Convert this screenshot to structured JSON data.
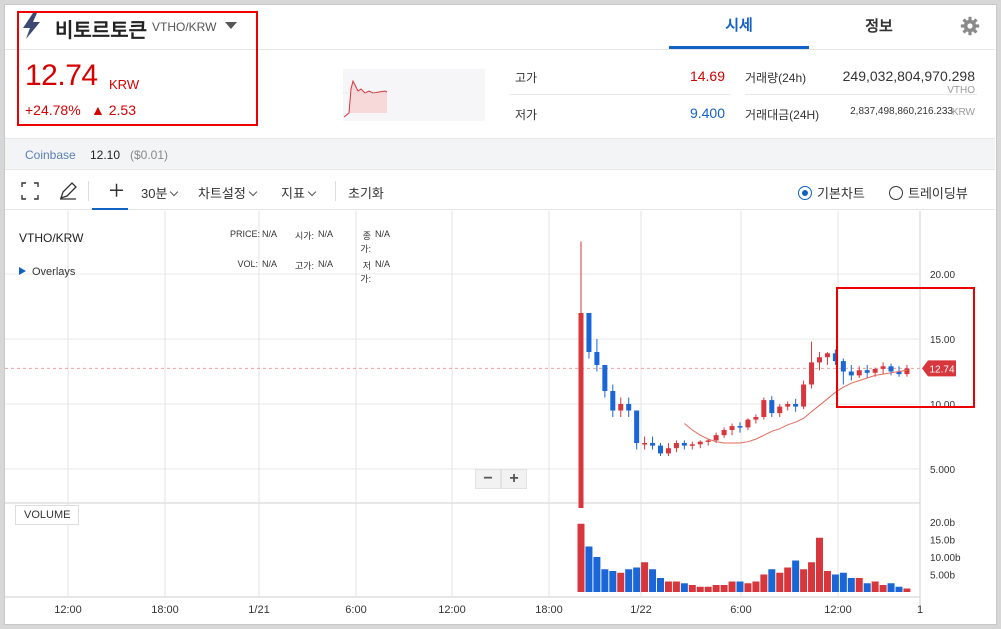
{
  "header": {
    "coin_name": "비토르토큰",
    "pair": "VTHO/KRW",
    "tabs": [
      "시세",
      "정보"
    ],
    "icons": {
      "coin": "lightning-bolt-icon",
      "dropdown": "caret-down-icon",
      "settings": "gear-icon"
    }
  },
  "ticker": {
    "price": "12.74",
    "unit": "KRW",
    "change_rate": "+24.78%",
    "change_amount": "▲ 2.53",
    "color_up": "#d60000"
  },
  "stats": {
    "high_label": "고가",
    "high_value": "14.69",
    "low_label": "저가",
    "low_value": "9.400",
    "volume_label": "거래량(24h)",
    "volume_value": "249,032,804,970.298",
    "volume_unit": "VTHO",
    "amount_label": "거래대금(24H)",
    "amount_value": "2,837,498,860,216.233",
    "amount_unit": "KRW"
  },
  "exchange": {
    "name": "Coinbase",
    "price": "12.10",
    "usd": "($0.01)"
  },
  "toolbar": {
    "interval": "30분",
    "chart_settings": "차트설정",
    "indicators": "지표",
    "reset": "초기화",
    "radio_basic": "기본차트",
    "radio_trading": "트레이딩뷰",
    "icons": [
      "crosshair-frame-icon",
      "pencil-icon",
      "plus-crosshair-icon"
    ]
  },
  "chart_info": {
    "symbol": "VTHO/KRW",
    "overlays": "Overlays",
    "price_label": "PRICE:",
    "price_value": "N/A",
    "open_label": "시가:",
    "open_value": "N/A",
    "close_label": "종가:",
    "close_value": "N/A",
    "vol_label": "VOL:",
    "vol_value": "N/A",
    "high_label": "고가:",
    "high_value": "N/A",
    "low_label": "저가:",
    "low_value": "N/A",
    "volume_title": "VOLUME",
    "current_price_tag": "12.74",
    "zoom_out": "−",
    "zoom_in": "+"
  },
  "chart_data": {
    "type": "candlestick",
    "y_ticks": [
      "20.00",
      "15.00",
      "10.00",
      "5.000"
    ],
    "volume_ticks": [
      "20.0b",
      "15.0b",
      "10.00b",
      "5.00b"
    ],
    "x_ticks": [
      "12:00",
      "18:00",
      "1/21",
      "6:00",
      "12:00",
      "18:00",
      "1/22",
      "6:00",
      "12:00",
      "1"
    ],
    "ylim": [
      0,
      24
    ],
    "current_price": 12.74,
    "colors": {
      "up": "#d8363d",
      "down": "#1a66d6",
      "ma": "#e06b5a"
    },
    "candles": [
      [
        2.0,
        22.5,
        2.0,
        17.0
      ],
      [
        17.0,
        17.0,
        13.5,
        14.0
      ],
      [
        14.0,
        15.0,
        12.5,
        13.0
      ],
      [
        13.0,
        13.0,
        10.5,
        11.0
      ],
      [
        11.0,
        11.5,
        9.0,
        9.5
      ],
      [
        9.5,
        10.5,
        9.0,
        10.0
      ],
      [
        10.0,
        10.5,
        9.0,
        9.5
      ],
      [
        9.5,
        9.5,
        6.5,
        7.0
      ],
      [
        7.0,
        7.5,
        6.5,
        7.0
      ],
      [
        7.0,
        7.5,
        6.5,
        6.8
      ],
      [
        6.8,
        7.0,
        6.0,
        6.2
      ],
      [
        6.2,
        7.0,
        6.0,
        6.6
      ],
      [
        6.6,
        7.2,
        6.3,
        7.0
      ],
      [
        7.0,
        7.2,
        6.5,
        6.8
      ],
      [
        6.8,
        7.1,
        6.5,
        6.9
      ],
      [
        6.9,
        7.2,
        6.6,
        7.1
      ],
      [
        7.1,
        7.3,
        6.8,
        7.2
      ],
      [
        7.2,
        7.8,
        7.0,
        7.6
      ],
      [
        7.6,
        8.2,
        7.4,
        8.0
      ],
      [
        8.0,
        8.5,
        7.6,
        8.3
      ],
      [
        8.3,
        8.6,
        7.8,
        8.2
      ],
      [
        8.2,
        8.9,
        8.0,
        8.8
      ],
      [
        8.8,
        9.2,
        8.5,
        9.0
      ],
      [
        9.0,
        10.5,
        8.8,
        10.3
      ],
      [
        10.3,
        10.6,
        9.0,
        9.3
      ],
      [
        9.3,
        10.0,
        9.0,
        9.8
      ],
      [
        9.8,
        10.2,
        9.5,
        10.0
      ],
      [
        10.0,
        10.4,
        9.4,
        9.8
      ],
      [
        9.8,
        11.8,
        9.6,
        11.5
      ],
      [
        11.5,
        14.8,
        11.2,
        13.2
      ],
      [
        13.2,
        14.0,
        12.6,
        13.6
      ],
      [
        13.6,
        14.0,
        13.0,
        13.9
      ],
      [
        13.9,
        14.2,
        13.0,
        13.3
      ],
      [
        13.3,
        13.5,
        11.5,
        12.5
      ],
      [
        12.5,
        13.0,
        11.8,
        12.2
      ],
      [
        12.2,
        12.9,
        12.0,
        12.6
      ],
      [
        12.6,
        13.0,
        12.0,
        12.4
      ],
      [
        12.4,
        12.8,
        12.1,
        12.7
      ],
      [
        12.7,
        13.2,
        12.3,
        12.9
      ],
      [
        12.9,
        13.1,
        12.2,
        12.5
      ],
      [
        12.5,
        12.9,
        12.1,
        12.3
      ],
      [
        12.3,
        13.0,
        12.1,
        12.74
      ]
    ],
    "volumes": [
      19.5,
      13.0,
      10.0,
      6.5,
      6.0,
      5.5,
      6.5,
      7.0,
      8.5,
      6.5,
      4.0,
      3.0,
      3.0,
      2.5,
      2.0,
      1.5,
      1.5,
      2.0,
      2.0,
      3.0,
      3.0,
      2.5,
      3.0,
      5.0,
      6.5,
      5.5,
      7.0,
      9.0,
      6.5,
      8.5,
      15.5,
      6.0,
      5.0,
      5.5,
      4.0,
      4.0,
      2.5,
      3.0,
      2.0,
      2.5,
      1.5,
      1.0
    ],
    "ma": [
      null,
      null,
      null,
      null,
      null,
      null,
      null,
      null,
      null,
      null,
      null,
      null,
      null,
      8.5,
      8.0,
      7.6,
      7.3,
      7.1,
      7.0,
      7.0,
      7.0,
      7.1,
      7.3,
      7.6,
      7.9,
      8.1,
      8.4,
      8.6,
      8.9,
      9.4,
      9.9,
      10.4,
      10.9,
      11.3,
      11.6,
      11.8,
      12.0,
      12.2,
      12.3,
      12.4,
      12.5,
      12.6
    ]
  }
}
